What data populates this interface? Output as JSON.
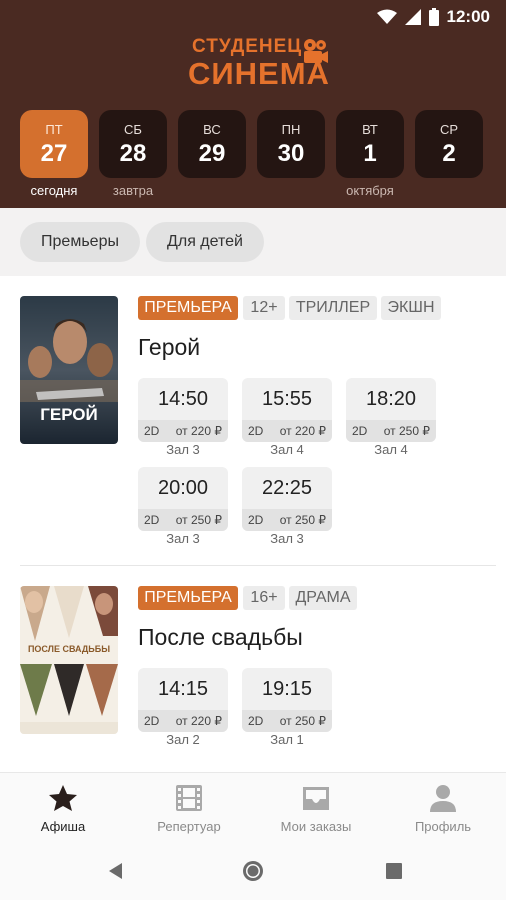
{
  "status": {
    "time": "12:00"
  },
  "logo": {
    "line1": "СТУДЕНЕЦ",
    "line2": "СИНЕМА"
  },
  "dates": [
    {
      "dow": "ПТ",
      "day": "27",
      "sub": "сегодня",
      "active": true
    },
    {
      "dow": "СБ",
      "day": "28",
      "sub": "завтра"
    },
    {
      "dow": "ВС",
      "day": "29",
      "sub": ""
    },
    {
      "dow": "ПН",
      "day": "30",
      "sub": ""
    },
    {
      "dow": "ВТ",
      "day": "1",
      "sub": "октября"
    },
    {
      "dow": "СР",
      "day": "2",
      "sub": ""
    }
  ],
  "filters": [
    "Премьеры",
    "Для детей"
  ],
  "movies": [
    {
      "title": "Герой",
      "poster_title": "ГЕРОЙ",
      "tags": [
        "ПРЕМЬЕРА",
        "12+",
        "ТРИЛЛЕР",
        "ЭКШН"
      ],
      "sessions": [
        {
          "time": "14:50",
          "format": "2D",
          "price": "от 220 ₽",
          "hall": "Зал 3"
        },
        {
          "time": "15:55",
          "format": "2D",
          "price": "от 220 ₽",
          "hall": "Зал 4"
        },
        {
          "time": "18:20",
          "format": "2D",
          "price": "от 250 ₽",
          "hall": "Зал 4"
        },
        {
          "time": "20:00",
          "format": "2D",
          "price": "от 250 ₽",
          "hall": "Зал 3"
        },
        {
          "time": "22:25",
          "format": "2D",
          "price": "от 250 ₽",
          "hall": "Зал 3"
        }
      ]
    },
    {
      "title": "После свадьбы",
      "poster_title": "ПОСЛЕ СВАДЬБЫ",
      "tags": [
        "ПРЕМЬЕРА",
        "16+",
        "ДРАМА"
      ],
      "sessions": [
        {
          "time": "14:15",
          "format": "2D",
          "price": "от 220 ₽",
          "hall": "Зал 2"
        },
        {
          "time": "19:15",
          "format": "2D",
          "price": "от 250 ₽",
          "hall": "Зал 1"
        }
      ]
    }
  ],
  "bottom_nav": [
    {
      "label": "Афиша",
      "icon": "star-icon",
      "active": true
    },
    {
      "label": "Репертуар",
      "icon": "film-icon"
    },
    {
      "label": "Мои заказы",
      "icon": "inbox-icon"
    },
    {
      "label": "Профиль",
      "icon": "person-icon"
    }
  ],
  "colors": {
    "header": "#4a2a22",
    "accent": "#d4702e",
    "card": "#241512"
  }
}
